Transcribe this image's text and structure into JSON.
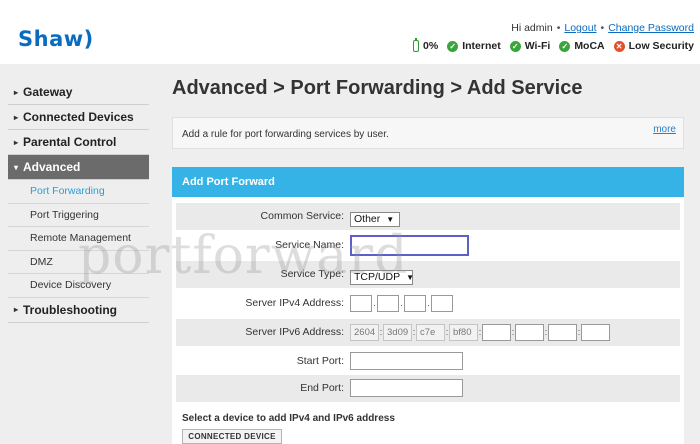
{
  "header": {
    "logo": "Shaw)",
    "greeting": "Hi admin",
    "logout": "Logout",
    "change_password": "Change Password",
    "status": {
      "battery": "0%",
      "internet": "Internet",
      "wifi": "Wi-Fi",
      "moca": "MoCA",
      "security": "Low Security"
    }
  },
  "sidebar": {
    "items": [
      {
        "label": "Gateway"
      },
      {
        "label": "Connected Devices"
      },
      {
        "label": "Parental Control"
      },
      {
        "label": "Advanced"
      },
      {
        "label": "Troubleshooting"
      }
    ],
    "subitems": [
      {
        "label": "Port Forwarding"
      },
      {
        "label": "Port Triggering"
      },
      {
        "label": "Remote Management"
      },
      {
        "label": "DMZ"
      },
      {
        "label": "Device Discovery"
      }
    ]
  },
  "main": {
    "title": "Advanced > Port Forwarding > Add Service",
    "info_text": "Add a rule for port forwarding services by user.",
    "more": "more"
  },
  "form": {
    "header": "Add Port Forward",
    "labels": {
      "common_service": "Common Service:",
      "service_name": "Service Name:",
      "service_type": "Service Type:",
      "server_ipv4": "Server IPv4 Address:",
      "server_ipv6": "Server IPv6 Address:",
      "start_port": "Start Port:",
      "end_port": "End Port:"
    },
    "values": {
      "common_service": "Other",
      "service_type": "TCP/UDP",
      "ipv6": [
        "2604",
        "3d09",
        "c7e",
        "bf80"
      ]
    },
    "device_prompt": "Select a device to add IPv4 and IPv6 address",
    "device_button": "CONNECTED DEVICE"
  },
  "watermark": "portforward"
}
